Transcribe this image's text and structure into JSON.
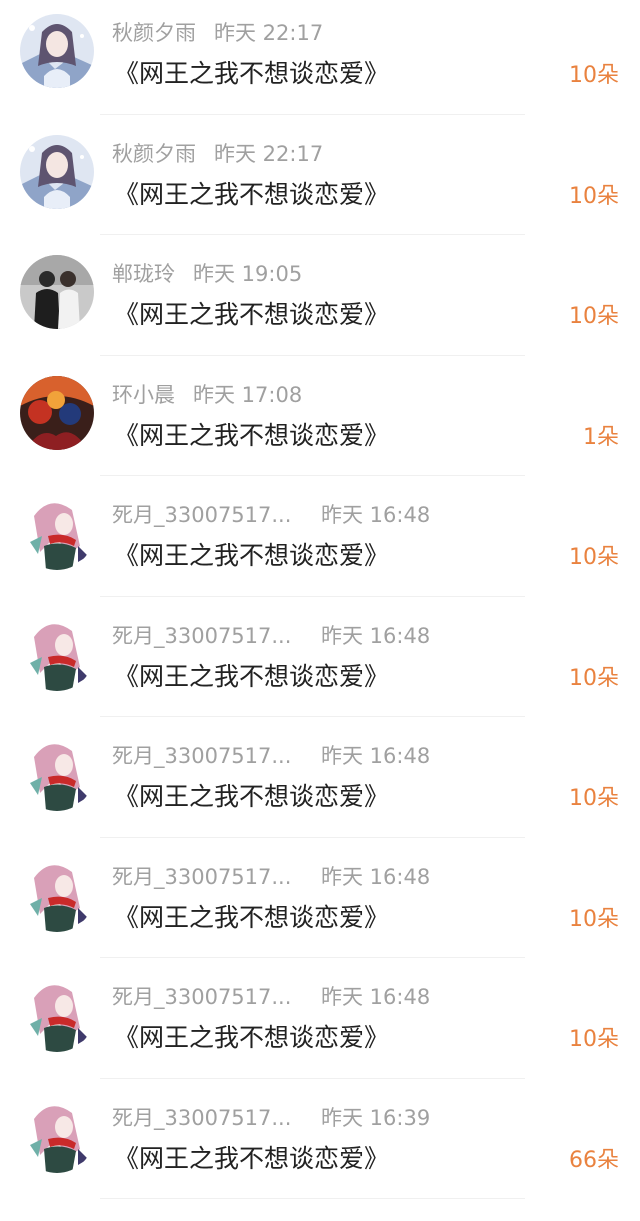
{
  "gifts": [
    {
      "user": "秋颜夕雨",
      "time": "昨天 22:17",
      "work": "《网王之我不想谈恋爱》",
      "amount": "10朵",
      "avatar": "girl-illustration-avatar"
    },
    {
      "user": "秋颜夕雨",
      "time": "昨天 22:17",
      "work": "《网王之我不想谈恋爱》",
      "amount": "10朵",
      "avatar": "girl-illustration-avatar"
    },
    {
      "user": "郸珑玲",
      "time": "昨天 19:05",
      "work": "《网王之我不想谈恋爱》",
      "amount": "10朵",
      "avatar": "couple-photo-avatar"
    },
    {
      "user": "环小晨",
      "time": "昨天 17:08",
      "work": "《网王之我不想谈恋爱》",
      "amount": "1朵",
      "avatar": "anime-group-avatar"
    },
    {
      "user": "死月_33007517...",
      "time": "昨天 16:48",
      "work": "《网王之我不想谈恋爱》",
      "amount": "10朵",
      "avatar": "pink-hair-girl-avatar"
    },
    {
      "user": "死月_33007517...",
      "time": "昨天 16:48",
      "work": "《网王之我不想谈恋爱》",
      "amount": "10朵",
      "avatar": "pink-hair-girl-avatar"
    },
    {
      "user": "死月_33007517...",
      "time": "昨天 16:48",
      "work": "《网王之我不想谈恋爱》",
      "amount": "10朵",
      "avatar": "pink-hair-girl-avatar"
    },
    {
      "user": "死月_33007517...",
      "time": "昨天 16:48",
      "work": "《网王之我不想谈恋爱》",
      "amount": "10朵",
      "avatar": "pink-hair-girl-avatar"
    },
    {
      "user": "死月_33007517...",
      "time": "昨天 16:48",
      "work": "《网王之我不想谈恋爱》",
      "amount": "10朵",
      "avatar": "pink-hair-girl-avatar"
    },
    {
      "user": "死月_33007517...",
      "time": "昨天 16:39",
      "work": "《网王之我不想谈恋爱》",
      "amount": "66朵",
      "avatar": "pink-hair-girl-avatar"
    }
  ],
  "colors": {
    "meta_text": "#a0a0a0",
    "title_text": "#222222",
    "amount_text": "#e9823f",
    "divider": "#f0f0f0"
  }
}
